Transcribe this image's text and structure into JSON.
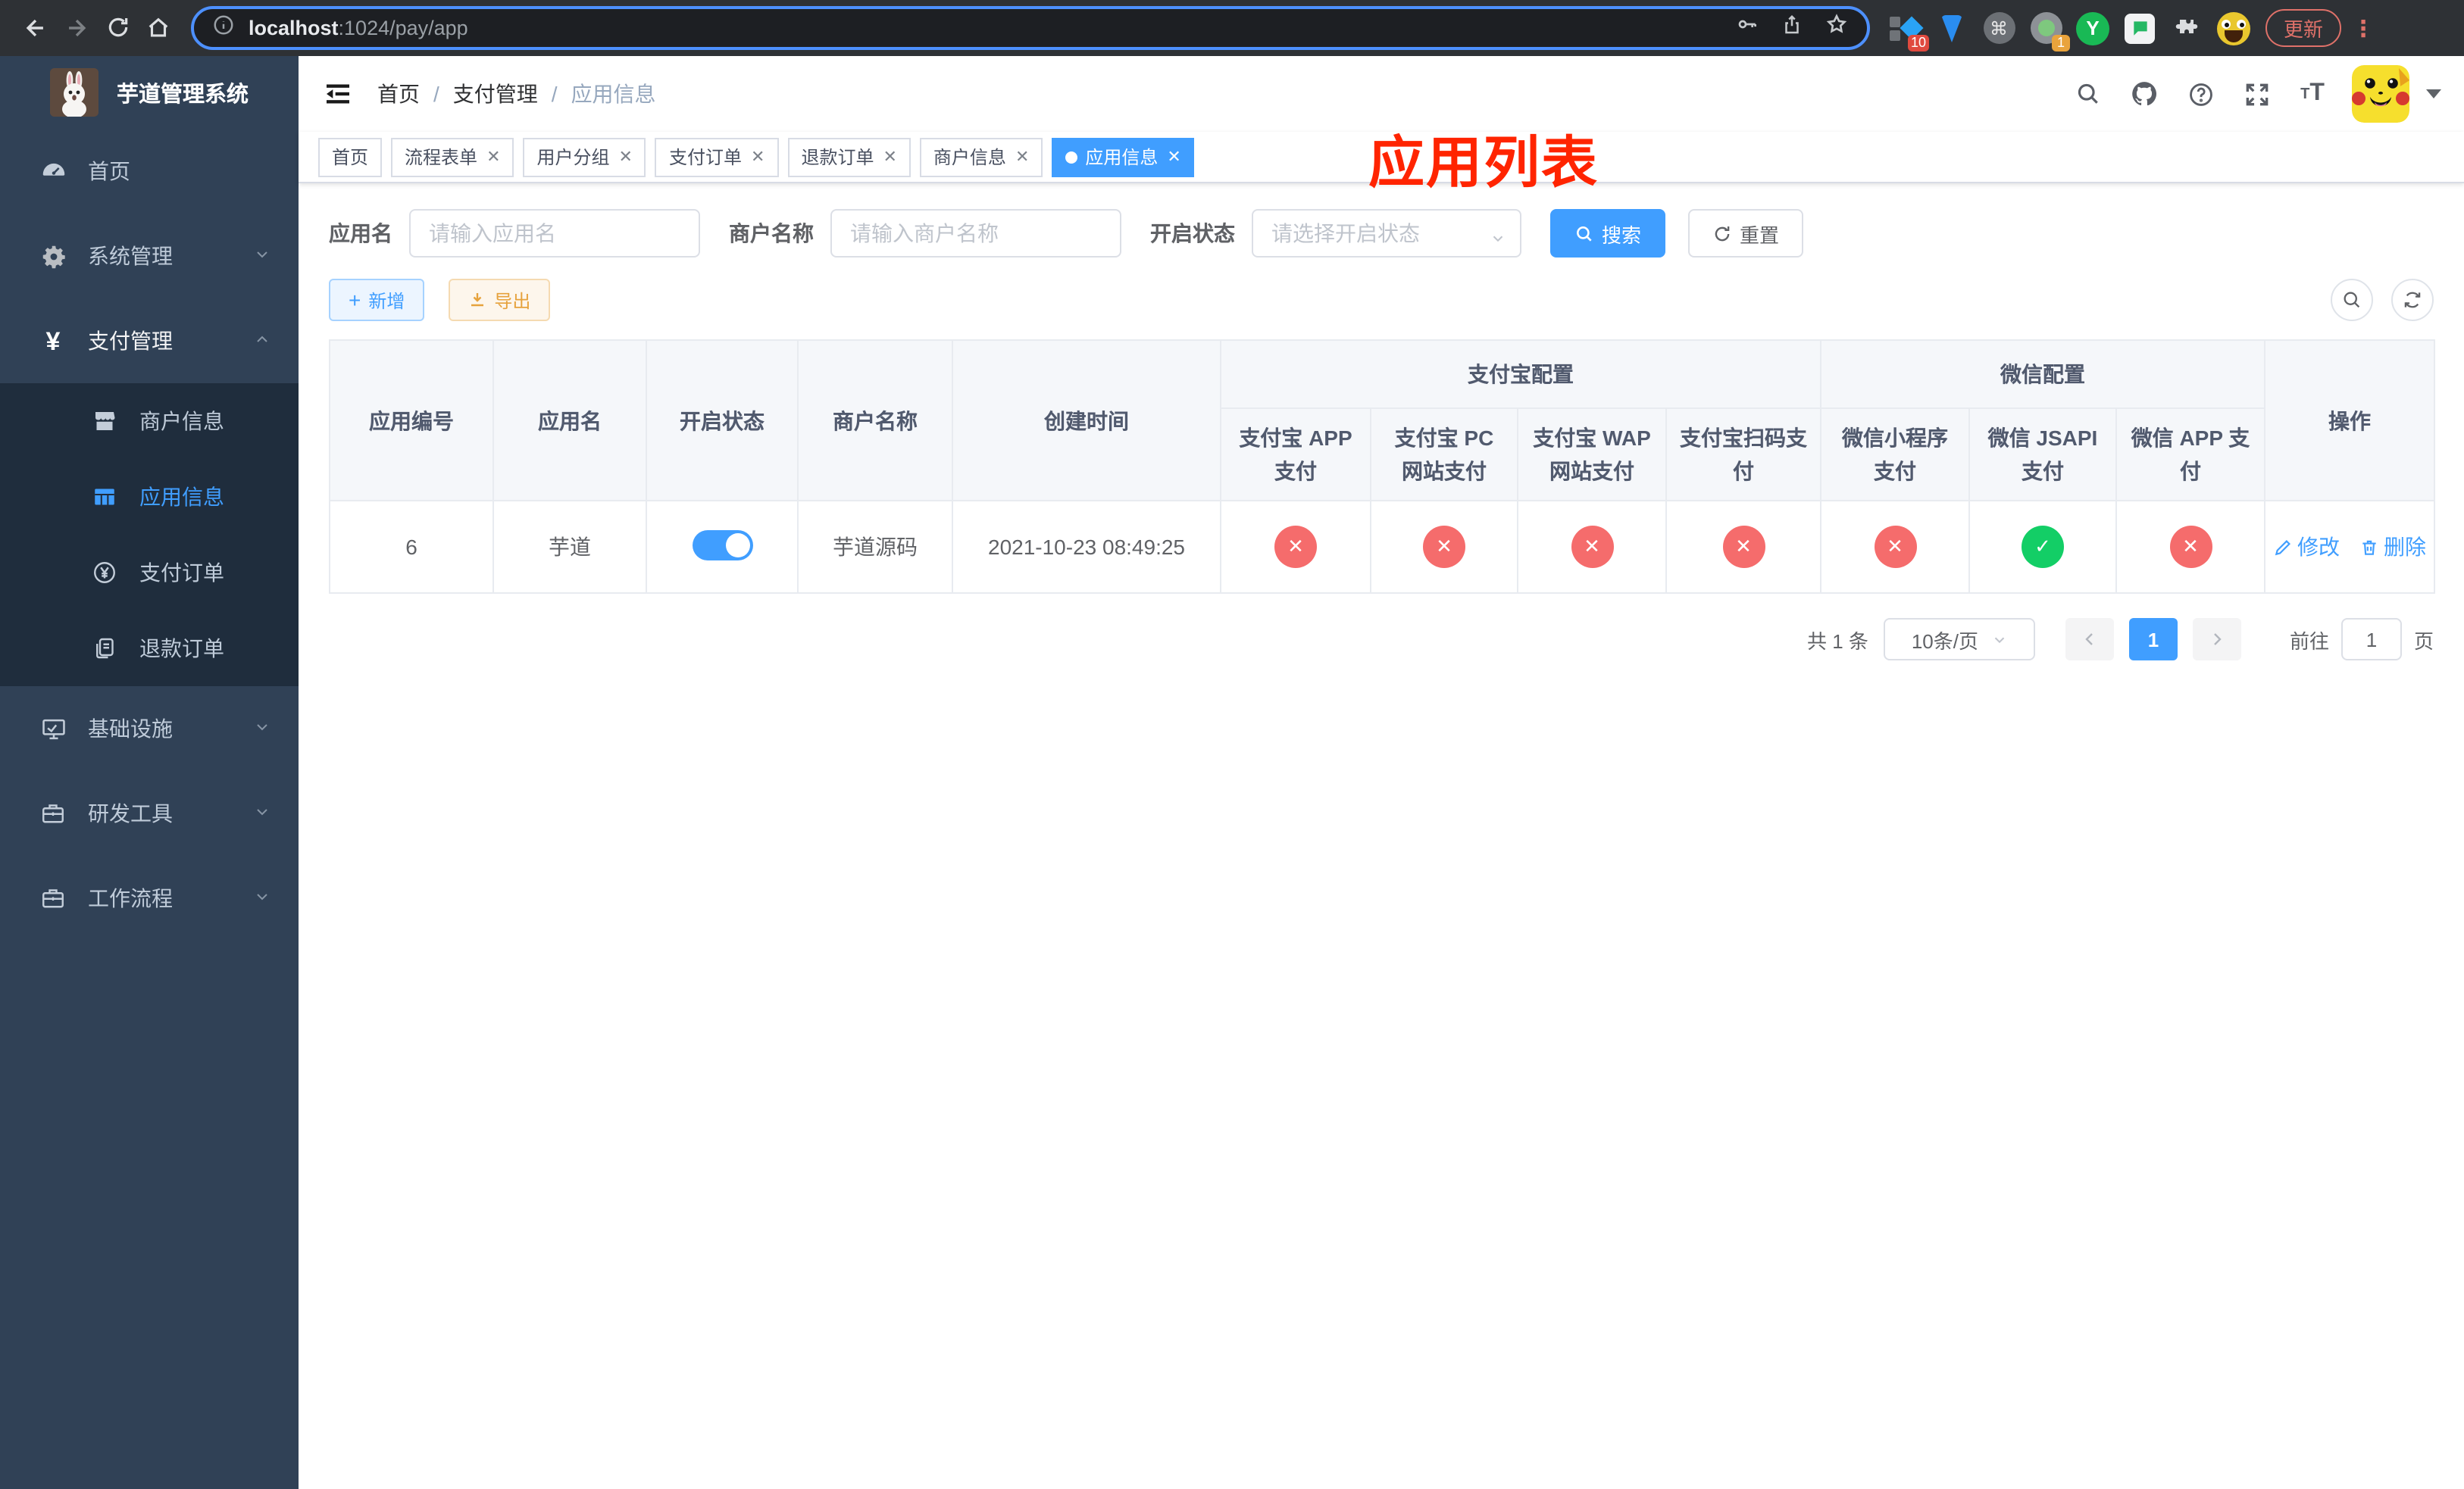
{
  "browser": {
    "url_host": "localhost",
    "url_rest": ":1024/pay/app",
    "update_label": "更新",
    "ext_badge_blue": "10",
    "ext_badge_profile": "1",
    "ext_y_label": "Y",
    "ext_cmd_label": "⌘"
  },
  "sidebar": {
    "title": "芋道管理系统",
    "items": [
      {
        "label": "首页"
      },
      {
        "label": "系统管理"
      },
      {
        "label": "支付管理"
      },
      {
        "label": "商户信息"
      },
      {
        "label": "应用信息"
      },
      {
        "label": "支付订单"
      },
      {
        "label": "退款订单"
      },
      {
        "label": "基础设施"
      },
      {
        "label": "研发工具"
      },
      {
        "label": "工作流程"
      }
    ]
  },
  "navbar": {
    "breadcrumb": [
      "首页",
      "支付管理",
      "应用信息"
    ],
    "overlay_title": "应用列表"
  },
  "tabs": [
    {
      "label": "首页"
    },
    {
      "label": "流程表单"
    },
    {
      "label": "用户分组"
    },
    {
      "label": "支付订单"
    },
    {
      "label": "退款订单"
    },
    {
      "label": "商户信息"
    },
    {
      "label": "应用信息"
    }
  ],
  "filters": {
    "app_name_label": "应用名",
    "app_name_placeholder": "请输入应用名",
    "merchant_label": "商户名称",
    "merchant_placeholder": "请输入商户名称",
    "status_label": "开启状态",
    "status_placeholder": "请选择开启状态",
    "search_label": "搜索",
    "reset_label": "重置"
  },
  "toolbar": {
    "add_label": "新增",
    "export_label": "导出"
  },
  "table": {
    "headers": [
      "应用编号",
      "应用名",
      "开启状态",
      "商户名称",
      "创建时间"
    ],
    "alipay_group": {
      "label": "支付宝配置",
      "cols": [
        "支付宝 APP 支付",
        "支付宝 PC 网站支付",
        "支付宝 WAP 网站支付",
        "支付宝扫码支付"
      ]
    },
    "wechat_group": {
      "label": "微信配置",
      "cols": [
        "微信小程序支付",
        "微信 JSAPI 支付",
        "微信 APP 支付"
      ]
    },
    "action_header": "操作",
    "rows": [
      {
        "id": "6",
        "name": "芋道",
        "enabled": true,
        "merchant": "芋道源码",
        "created": "2021-10-23 08:49:25",
        "statuses": [
          "no",
          "no",
          "no",
          "no",
          "no",
          "yes",
          "no"
        ],
        "edit_label": "修改",
        "delete_label": "删除"
      }
    ]
  },
  "pagination": {
    "total": "共 1 条",
    "page_size": "10条/页",
    "page": "1",
    "goto_label": "前往",
    "goto_value": "1",
    "page_suffix": "页"
  },
  "colors": {
    "primary": "#409eff",
    "sidebar_bg": "#304156",
    "submenu_bg": "#1f2d3d",
    "danger": "#f56c6c",
    "success": "#13ce66",
    "warning": "#e6a23c",
    "overlay_red": "#ff2400"
  }
}
